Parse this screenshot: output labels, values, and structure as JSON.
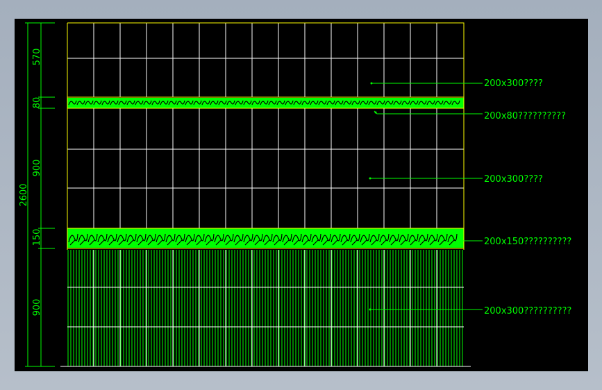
{
  "colors": {
    "background": "#000000",
    "outline": "#ffff00",
    "grid": "#ffffff",
    "dimension": "#00ff00",
    "label": "#00ff00",
    "pattern": "#00ff00"
  },
  "dimensions": {
    "total": "2600",
    "segments": [
      "570",
      "80",
      "900",
      "150",
      "900"
    ]
  },
  "callouts": [
    "200x300????",
    "200x80??????????",
    "200x300????",
    "200x150??????????",
    "200x300??????????"
  ]
}
